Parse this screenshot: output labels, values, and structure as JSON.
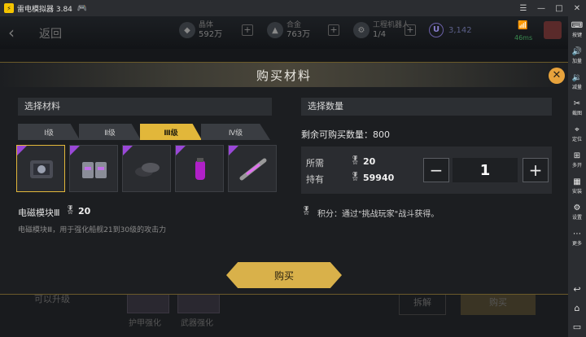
{
  "emulator": {
    "title": "雷电模拟器 3.84",
    "sidebar": [
      {
        "icon": "keyboard-icon",
        "glyph": "⌨",
        "label": "按键"
      },
      {
        "icon": "volume-up-icon",
        "glyph": "🔊",
        "label": "加量"
      },
      {
        "icon": "volume-down-icon",
        "glyph": "🔉",
        "label": "减量"
      },
      {
        "icon": "scissors-icon",
        "glyph": "✂",
        "label": "截图"
      },
      {
        "icon": "location-icon",
        "glyph": "⌖",
        "label": "定位"
      },
      {
        "icon": "multi-open-icon",
        "glyph": "⊞",
        "label": "多开"
      },
      {
        "icon": "install-icon",
        "glyph": "▦",
        "label": "安装"
      },
      {
        "icon": "settings-icon",
        "glyph": "⚙",
        "label": "设置"
      },
      {
        "icon": "more-icon",
        "glyph": "⋯",
        "label": "更多"
      }
    ]
  },
  "topbar": {
    "back_label": "返回",
    "resources": [
      {
        "name": "晶体",
        "value": "592万"
      },
      {
        "name": "合金",
        "value": "763万"
      },
      {
        "name": "工程机器人",
        "value": "1/4"
      }
    ],
    "u_badge": "U",
    "u_value": "3,142",
    "ping": "46ms"
  },
  "modal": {
    "title": "购买材料",
    "select_material_label": "选择材料",
    "select_quantity_label": "选择数量",
    "tabs": [
      {
        "label": "Ⅰ级",
        "active": false
      },
      {
        "label": "Ⅱ级",
        "active": false
      },
      {
        "label": "Ⅲ级",
        "active": true
      },
      {
        "label": "Ⅳ级",
        "active": false
      }
    ],
    "materials": [
      {
        "name": "electromagnetic-module",
        "selected": true
      },
      {
        "name": "armor-plates",
        "selected": false
      },
      {
        "name": "dark-discs",
        "selected": false
      },
      {
        "name": "purple-capsule",
        "selected": false
      },
      {
        "name": "energy-rod",
        "selected": false
      }
    ],
    "selected_material": {
      "name": "电磁模块Ⅲ",
      "cost": "20",
      "description": "电磁模块Ⅲ，用于强化船舰21到30级的攻击力"
    },
    "remaining_label": "剩余可购买数量：800",
    "required_label": "所需",
    "required_value": "20",
    "owned_label": "持有",
    "owned_value": "59940",
    "quantity": "1",
    "minus": "−",
    "plus": "+",
    "points_text": "积分：通过\"挑战玩家\"战斗获得。",
    "buy_label": "购买"
  },
  "background": {
    "upgradable_label": "可以升级",
    "skills": [
      "护甲强化",
      "武器强化"
    ],
    "dismantle_label": "拆解",
    "buy_label": "购买"
  }
}
